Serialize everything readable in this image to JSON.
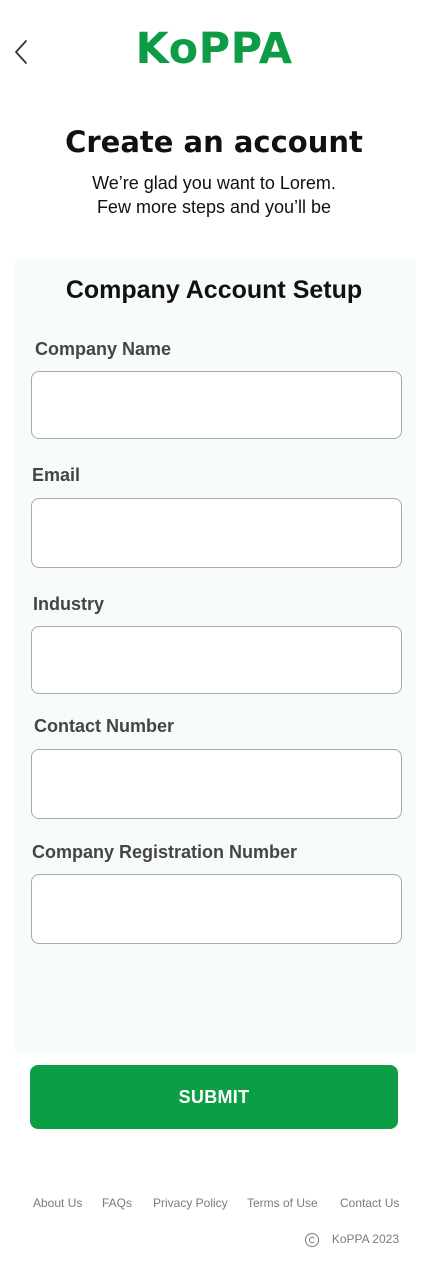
{
  "header": {
    "brand": "KoPPA",
    "back_icon": "chevron-left-icon"
  },
  "intro": {
    "title": "Create an account",
    "subtitle_line1": "We’re glad you want to Lorem.",
    "subtitle_line2": "Few more steps and you’ll be"
  },
  "form": {
    "title": "Company Account Setup",
    "fields": [
      {
        "label": "Company Name",
        "value": "",
        "placeholder": ""
      },
      {
        "label": "Email",
        "value": "",
        "placeholder": ""
      },
      {
        "label": "Industry",
        "value": "",
        "placeholder": ""
      },
      {
        "label": "Contact Number",
        "value": "",
        "placeholder": ""
      },
      {
        "label": "Company Registration Number",
        "value": "",
        "placeholder": ""
      }
    ],
    "submit_label": "SUBMIT"
  },
  "footer": {
    "links": [
      "About Us",
      "FAQs",
      "Privacy Policy",
      "Terms of Use",
      "Contact Us"
    ],
    "copyright_icon": "copyright-icon",
    "copyright": "KoPPA 2023"
  },
  "colors": {
    "brand": "#0c9c46",
    "button": "#0c9e45",
    "panel": "#f8fcf8",
    "footer_text": "#7b7b7b"
  }
}
